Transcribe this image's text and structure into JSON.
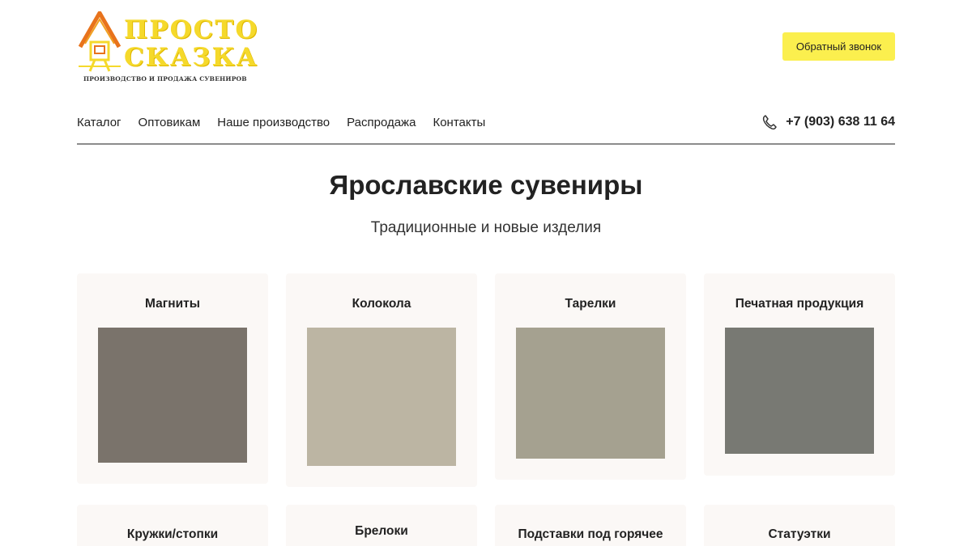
{
  "header": {
    "logo": {
      "line1": "ПРОСТО",
      "line2": "СКАЗКА",
      "tagline": "ПРОИЗВОДСТВО И ПРОДАЖА СУВЕНИРОВ",
      "colors": {
        "text": "#f5d92b",
        "roof": "#e8731c"
      }
    },
    "callback_label": "Обратный звонок",
    "nav": [
      "Каталог",
      "Оптовикам",
      "Наше производство",
      "Распродажа",
      "Контакты"
    ],
    "phone": {
      "icon": "phone-icon",
      "number": "+7 (903) 638 11 64"
    }
  },
  "hero": {
    "title": "Ярославские сувениры",
    "subtitle": "Традиционные и новые изделия"
  },
  "categories": [
    {
      "label": "Магниты",
      "image_color": "#7a736b"
    },
    {
      "label": "Колокола",
      "image_color": "#bcb5a3"
    },
    {
      "label": "Тарелки",
      "image_color": "#a5a190"
    },
    {
      "label": "Печатная продукция",
      "image_color": "#787973"
    },
    {
      "label": "Кружки/стопки",
      "image_color": ""
    },
    {
      "label": "Брелоки",
      "image_color": ""
    },
    {
      "label": "Подставки под горячее",
      "image_color": ""
    },
    {
      "label": "Статуэтки",
      "image_color": ""
    }
  ],
  "colors": {
    "accent_button": "#fbef4e",
    "card_background": "#fbf8f6",
    "divider": "#8c8c8c"
  }
}
